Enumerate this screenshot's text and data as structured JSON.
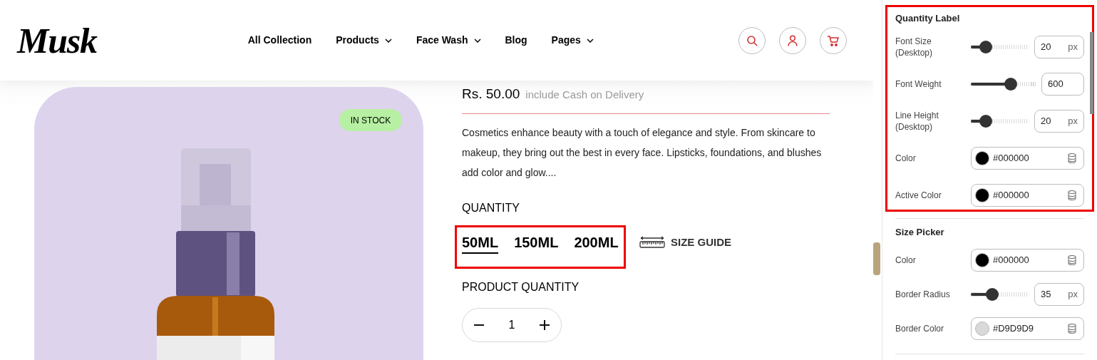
{
  "header": {
    "logo": "Musk",
    "nav": [
      {
        "label": "All Collection",
        "dropdown": false
      },
      {
        "label": "Products",
        "dropdown": true
      },
      {
        "label": "Face Wash",
        "dropdown": true
      },
      {
        "label": "Blog",
        "dropdown": false
      },
      {
        "label": "Pages",
        "dropdown": true
      }
    ]
  },
  "product": {
    "badge": "IN STOCK",
    "price": "Rs. 50.00",
    "price_note": "include Cash on Delivery",
    "description": "Cosmetics enhance beauty with a touch of elegance and style. From skincare to makeup, they bring out the best in every face. Lipsticks, foundations, and blushes add color and glow....",
    "quantity_label": "QUANTITY",
    "sizes_highlighted": true,
    "sizes": [
      {
        "label": "50ML",
        "selected": true
      },
      {
        "label": "150ML",
        "selected": false
      },
      {
        "label": "200ML",
        "selected": false
      }
    ],
    "size_guide": "SIZE GUIDE",
    "product_quantity_label": "PRODUCT QUANTITY",
    "quantity": "1"
  },
  "sidebar": {
    "sections": [
      {
        "title": "Quantity Label",
        "highlighted": true,
        "controls": [
          {
            "kind": "slider",
            "label": "Font Size (Desktop)",
            "level": 0.26,
            "value": "20",
            "unit": "px"
          },
          {
            "kind": "slider",
            "label": "Font Weight",
            "level": 0.61,
            "value": "600"
          },
          {
            "kind": "slider",
            "label": "Line Height (Desktop)",
            "level": 0.26,
            "value": "20",
            "unit": "px"
          },
          {
            "kind": "color",
            "label": "Color",
            "value": "#000000",
            "color": "#000000"
          },
          {
            "kind": "color",
            "label": "Active Color",
            "value": "#000000",
            "color": "#000000"
          }
        ]
      },
      {
        "title": "Size Picker",
        "highlighted": false,
        "controls": [
          {
            "kind": "color",
            "label": "Color",
            "value": "#000000",
            "color": "#000000"
          },
          {
            "kind": "slider",
            "label": "Border Radius",
            "level": 0.37,
            "value": "35",
            "unit": "px"
          },
          {
            "kind": "color",
            "label": "Border Color",
            "value": "#D9D9D9",
            "color": "#d9d9d9"
          }
        ]
      }
    ]
  }
}
